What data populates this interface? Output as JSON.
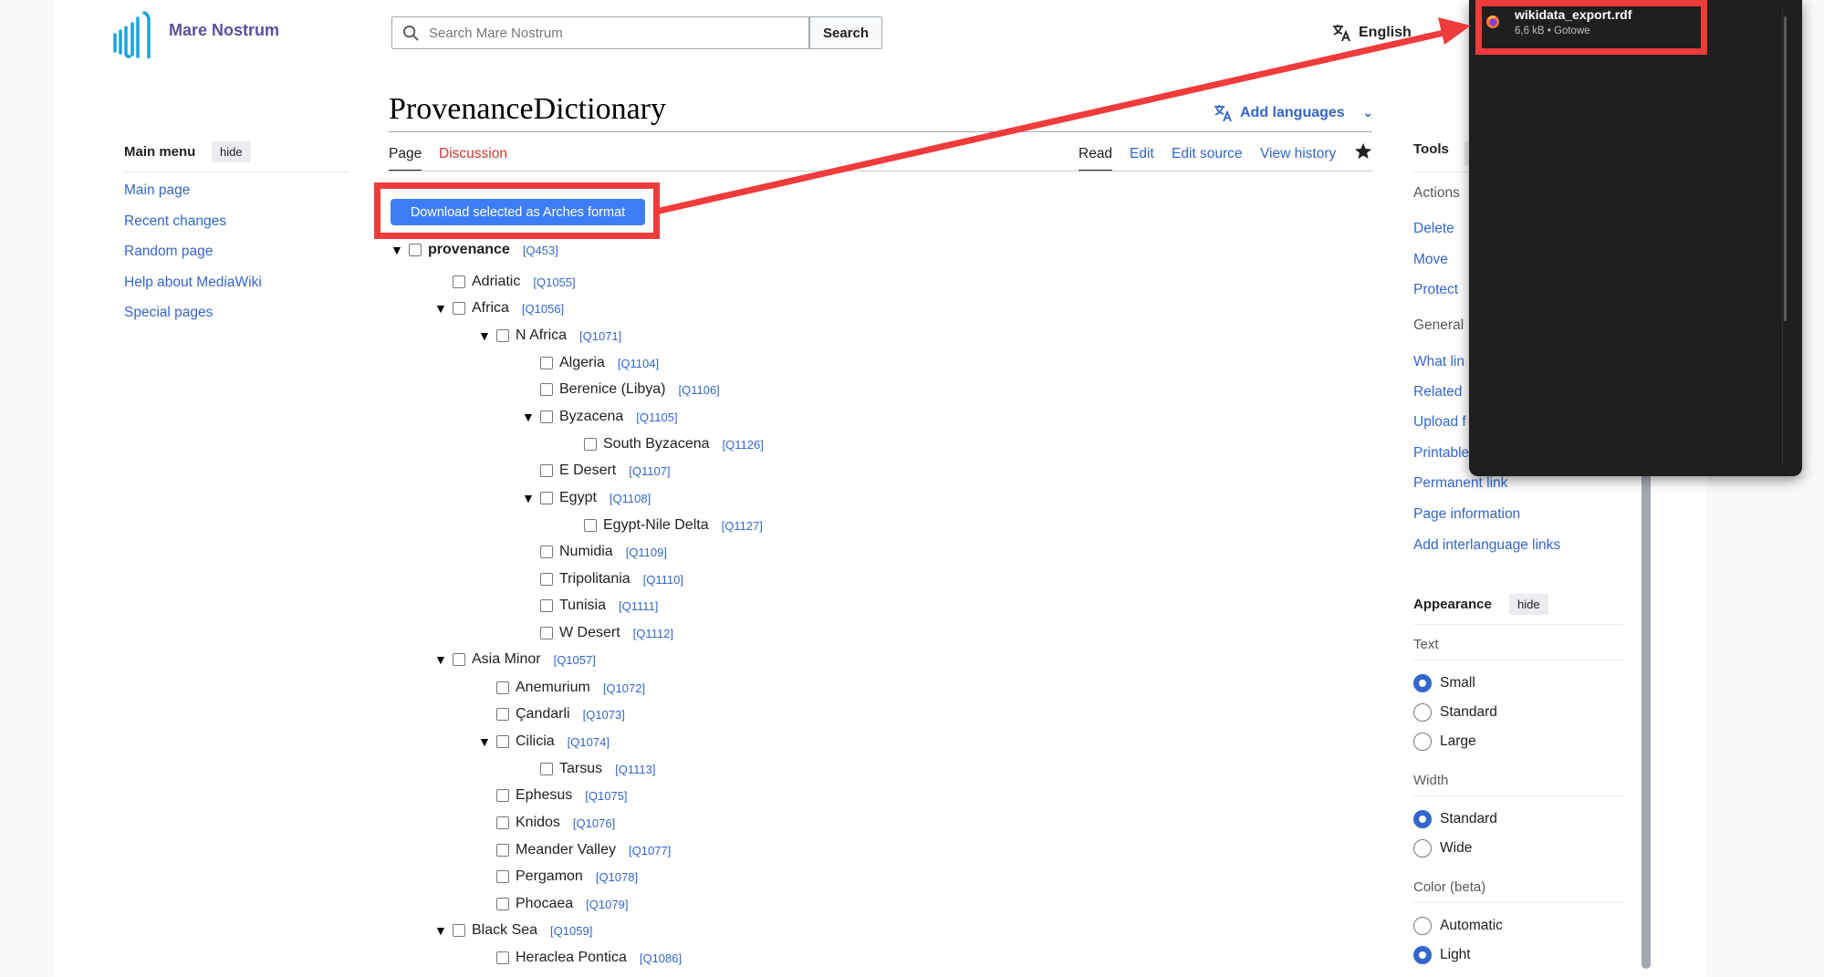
{
  "site": {
    "name": "Mare Nostrum"
  },
  "search": {
    "placeholder": "Search Mare Nostrum",
    "button_label": "Search"
  },
  "language": {
    "current": "English",
    "add_languages": "Add languages"
  },
  "main_menu": {
    "title": "Main menu",
    "hide_label": "hide",
    "items": [
      "Main page",
      "Recent changes",
      "Random page",
      "Help about MediaWiki",
      "Special pages"
    ]
  },
  "page": {
    "title": "ProvenanceDictionary",
    "tabs_left": [
      "Page",
      "Discussion"
    ],
    "tabs_right": [
      "Read",
      "Edit",
      "Edit source",
      "View history"
    ],
    "download_button": "Download selected as Arches format"
  },
  "tree": [
    {
      "label": "provenance",
      "qid": "[Q453]",
      "depth": 0,
      "expanded": true,
      "root": true
    },
    {
      "label": "Adriatic",
      "qid": "[Q1055]",
      "depth": 1,
      "expanded": false
    },
    {
      "label": "Africa",
      "qid": "[Q1056]",
      "depth": 1,
      "expanded": true
    },
    {
      "label": "N Africa",
      "qid": "[Q1071]",
      "depth": 2,
      "expanded": true
    },
    {
      "label": "Algeria",
      "qid": "[Q1104]",
      "depth": 3,
      "expanded": false
    },
    {
      "label": "Berenice (Libya)",
      "qid": "[Q1106]",
      "depth": 3,
      "expanded": false
    },
    {
      "label": "Byzacena",
      "qid": "[Q1105]",
      "depth": 3,
      "expanded": true
    },
    {
      "label": "South Byzacena",
      "qid": "[Q1126]",
      "depth": 4,
      "expanded": false
    },
    {
      "label": "E Desert",
      "qid": "[Q1107]",
      "depth": 3,
      "expanded": false
    },
    {
      "label": "Egypt",
      "qid": "[Q1108]",
      "depth": 3,
      "expanded": true
    },
    {
      "label": "Egypt-Nile Delta",
      "qid": "[Q1127]",
      "depth": 4,
      "expanded": false
    },
    {
      "label": "Numidia",
      "qid": "[Q1109]",
      "depth": 3,
      "expanded": false
    },
    {
      "label": "Tripolitania",
      "qid": "[Q1110]",
      "depth": 3,
      "expanded": false
    },
    {
      "label": "Tunisia",
      "qid": "[Q1111]",
      "depth": 3,
      "expanded": false
    },
    {
      "label": "W Desert",
      "qid": "[Q1112]",
      "depth": 3,
      "expanded": false
    },
    {
      "label": "Asia Minor",
      "qid": "[Q1057]",
      "depth": 1,
      "expanded": true
    },
    {
      "label": "Anemurium",
      "qid": "[Q1072]",
      "depth": 2,
      "expanded": false
    },
    {
      "label": "Çandarli",
      "qid": "[Q1073]",
      "depth": 2,
      "expanded": false
    },
    {
      "label": "Cilicia",
      "qid": "[Q1074]",
      "depth": 2,
      "expanded": true
    },
    {
      "label": "Tarsus",
      "qid": "[Q1113]",
      "depth": 3,
      "expanded": false
    },
    {
      "label": "Ephesus",
      "qid": "[Q1075]",
      "depth": 2,
      "expanded": false
    },
    {
      "label": "Knidos",
      "qid": "[Q1076]",
      "depth": 2,
      "expanded": false
    },
    {
      "label": "Meander Valley",
      "qid": "[Q1077]",
      "depth": 2,
      "expanded": false
    },
    {
      "label": "Pergamon",
      "qid": "[Q1078]",
      "depth": 2,
      "expanded": false
    },
    {
      "label": "Phocaea",
      "qid": "[Q1079]",
      "depth": 2,
      "expanded": false
    },
    {
      "label": "Black Sea",
      "qid": "[Q1059]",
      "depth": 1,
      "expanded": true
    },
    {
      "label": "Heraclea Pontica",
      "qid": "[Q1086]",
      "depth": 2,
      "expanded": false
    }
  ],
  "tools": {
    "title": "Tools",
    "actions_label": "Actions",
    "actions": [
      "Delete",
      "Move",
      "Protect"
    ],
    "general_label": "General",
    "general_partial": [
      "What lin",
      "Related",
      "Upload f",
      "Printable"
    ],
    "general": [
      "Permanent link",
      "Page information",
      "Add interlanguage links"
    ]
  },
  "appearance": {
    "title": "Appearance",
    "hide_label": "hide",
    "text_label": "Text",
    "text_options": [
      "Small",
      "Standard",
      "Large"
    ],
    "text_selected": "Small",
    "width_label": "Width",
    "width_options": [
      "Standard",
      "Wide"
    ],
    "width_selected": "Standard",
    "color_label": "Color (beta)",
    "color_options": [
      "Automatic",
      "Light"
    ],
    "color_selected": "Light"
  },
  "download_popup": {
    "file_name": "wikidata_export.rdf",
    "meta": "6,6 kB • Gotowe"
  },
  "colors": {
    "link": "#3366cc",
    "highlight": "#ef3b3b",
    "button": "#3d7ef8",
    "popup_bg": "#1f1f1f"
  }
}
